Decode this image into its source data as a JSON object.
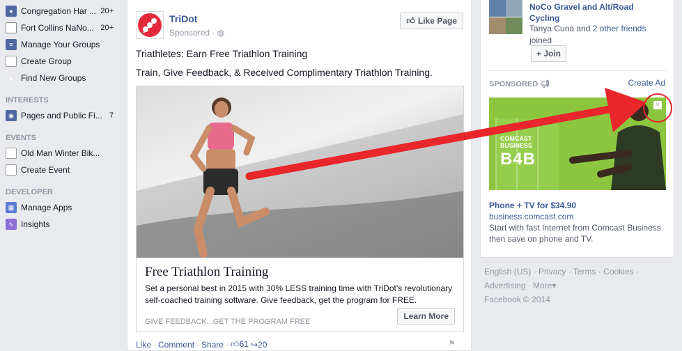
{
  "leftnav": {
    "items": [
      {
        "label": "Congregation Har ...",
        "count": "20+"
      },
      {
        "label": "Fort Collins NaNo...",
        "count": "20+"
      },
      {
        "label": "Manage Your Groups",
        "count": ""
      },
      {
        "label": "Create Group",
        "count": ""
      },
      {
        "label": "Find New Groups",
        "count": ""
      }
    ],
    "interests_heading": "INTERESTS",
    "interests": [
      {
        "label": "Pages and Public Fi...",
        "count": "7"
      }
    ],
    "events_heading": "EVENTS",
    "events": [
      {
        "label": "Old Man Winter Bik..."
      },
      {
        "label": "Create Event"
      }
    ],
    "developer_heading": "DEVELOPER",
    "developer": [
      {
        "label": "Manage Apps"
      },
      {
        "label": "Insights"
      }
    ]
  },
  "post": {
    "page_name": "TriDot",
    "sponsored": "Sponsored",
    "like_page": "Like Page",
    "text1": "Triathletes: Earn Free Triathlon Training",
    "text2": "Train, Give Feedback, & Received Complimentary Triathlon Training.",
    "ad_title": "Free Triathlon Training",
    "ad_desc": "Set a personal best in 2015 with 30% LESS training time with TriDot's revolutionary self-coached training software. Give feedback, get the program for FREE.",
    "ad_cta_text": "GIVE FEEDBACK...GET THE PROGRAM FREE",
    "learn_more": "Learn More",
    "actions": {
      "like": "Like",
      "comment": "Comment",
      "share": "Share",
      "likes_count": "61",
      "shares_count": "20"
    }
  },
  "right": {
    "group_name": "NoCo Gravel and Alt/Road Cycling",
    "friends_pre": "Tanya Cuna and",
    "friends_link": "2 other friends",
    "joined": "joined",
    "join_btn": "+ Join",
    "sponsored_label": "SPONSORED",
    "create_ad": "Create Ad",
    "side_ad": {
      "brand_line1": "COMCAST",
      "brand_line2": "BUSINESS",
      "logo": "B4B",
      "title": "Phone + TV for $34.90",
      "url": "business.comcast.com",
      "desc": "Start with fast Internet from Comcast Business then save on phone and TV."
    }
  },
  "footer": {
    "links": [
      "English (US)",
      "Privacy",
      "Terms",
      "Cookies",
      "Advertising",
      "More"
    ],
    "copyright": "Facebook © 2014"
  },
  "colors": {
    "brand": "#3b5998",
    "annotation_red": "#e8262b",
    "ad_green": "#8cc63f"
  }
}
